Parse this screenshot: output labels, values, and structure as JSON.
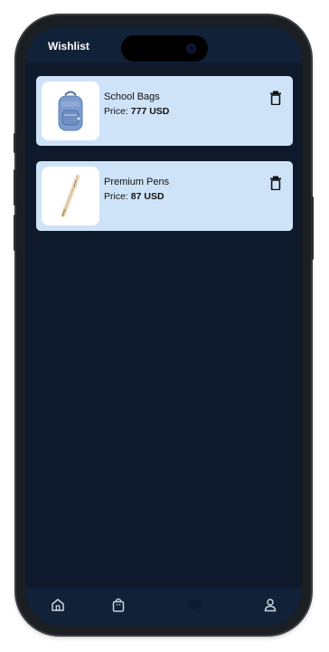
{
  "app": {
    "title": "Wishlist"
  },
  "items": [
    {
      "name": "School Bags",
      "price_label": "Price:",
      "price_value": "777 USD",
      "image": "backpack"
    },
    {
      "name": "Premium Pens",
      "price_label": "Price:",
      "price_value": "87 USD",
      "image": "pen"
    }
  ],
  "nav": {
    "items": [
      {
        "icon": "home-icon",
        "active": false
      },
      {
        "icon": "shopping-bag-icon",
        "active": false
      },
      {
        "icon": "heart-icon",
        "active": true
      },
      {
        "icon": "user-icon",
        "active": false
      }
    ]
  },
  "colors": {
    "background": "#0e1a2b",
    "bar": "#112138",
    "card": "#cfe3f8",
    "active_icon": "#0d1a33",
    "inactive_icon": "#c9d3df"
  }
}
